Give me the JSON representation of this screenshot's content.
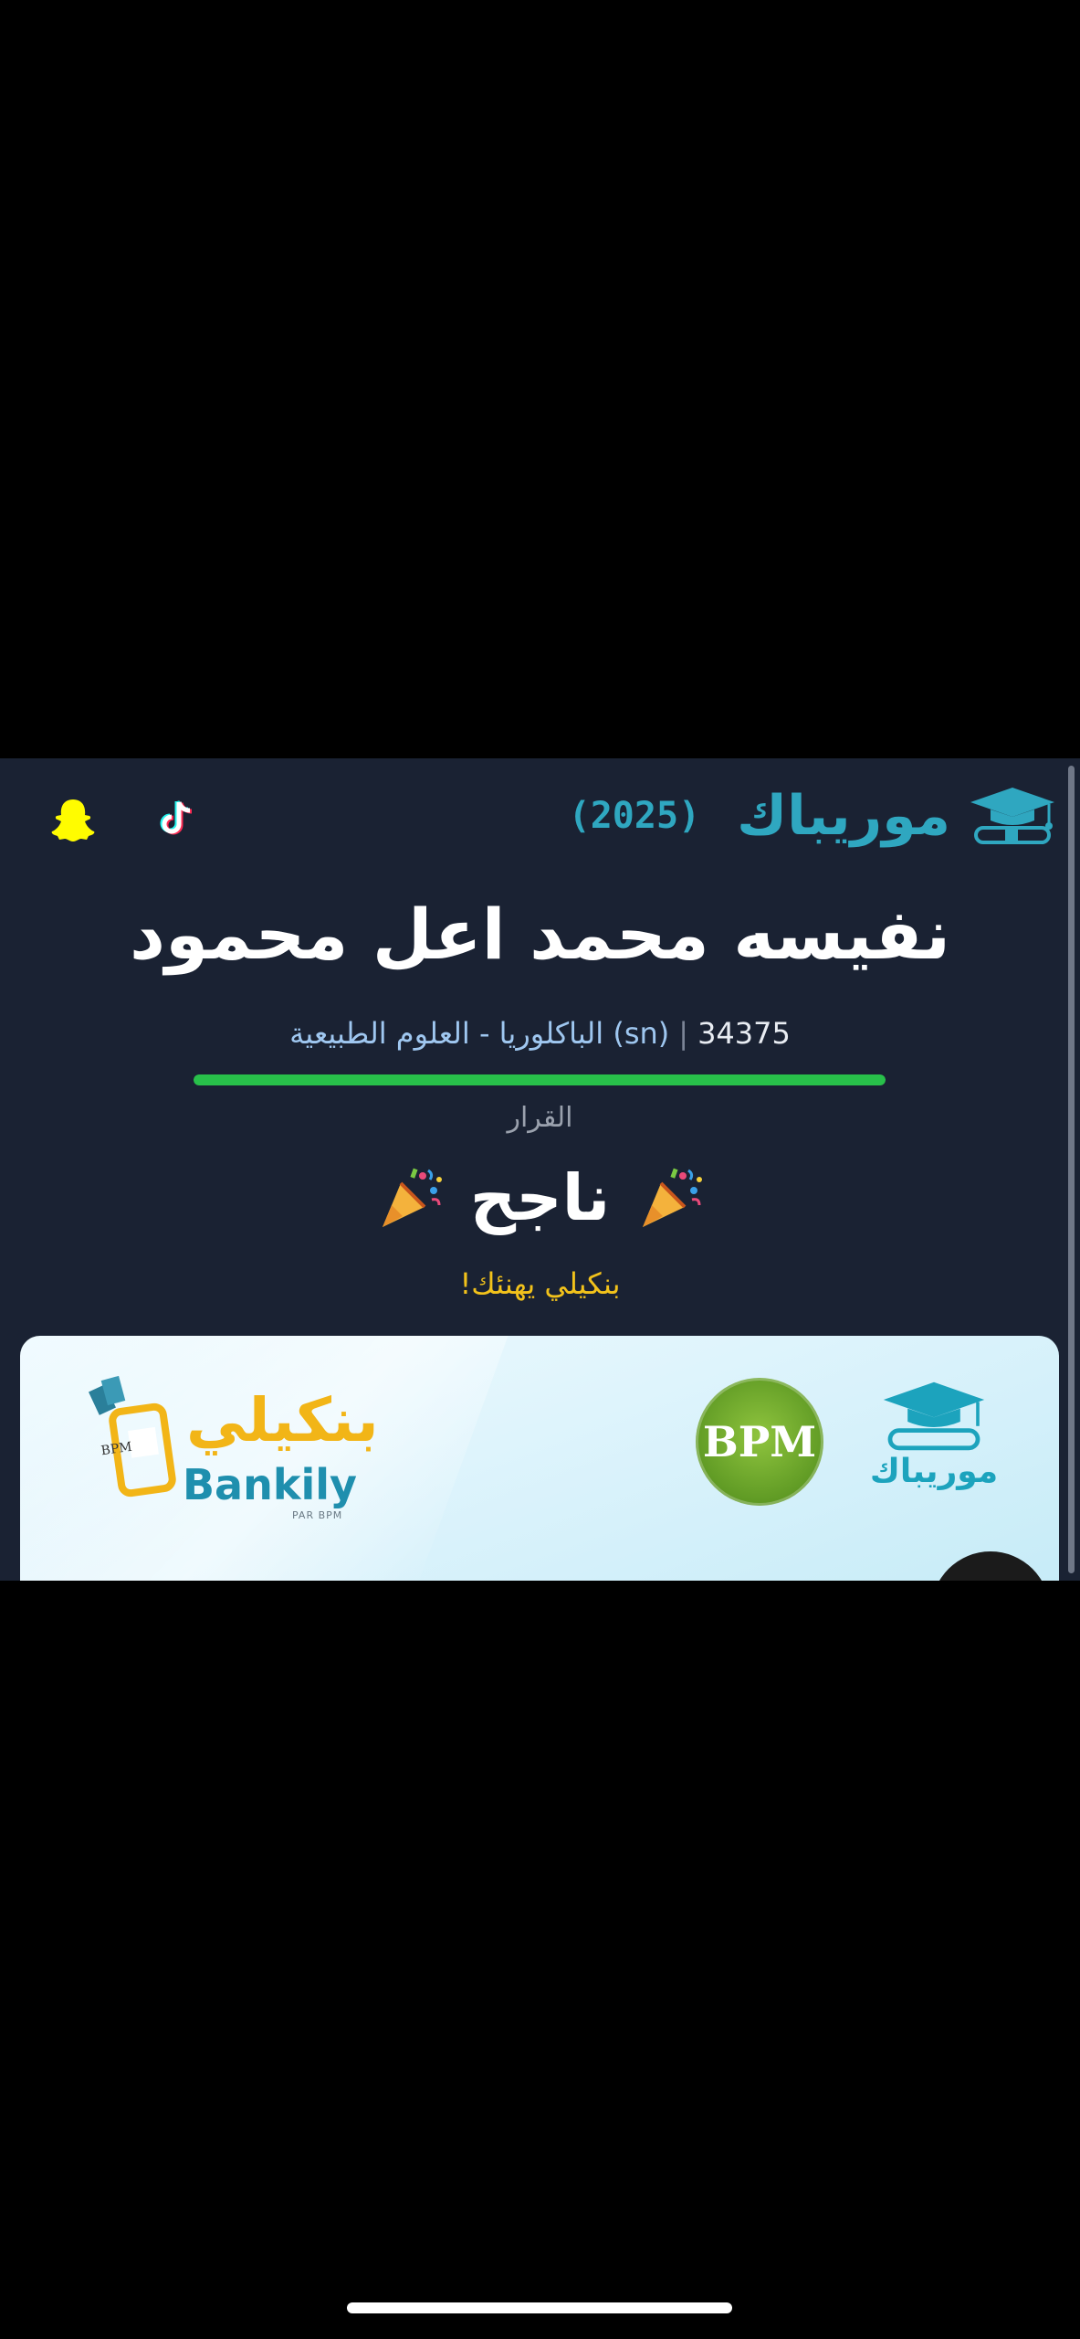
{
  "header": {
    "brand_name": "موريباك",
    "year": "(2025)",
    "icons": {
      "brand": "graduation-cap-icon",
      "tiktok": "tiktok-icon",
      "snapchat": "snapchat-icon"
    }
  },
  "student": {
    "name": "نفيسه محمد اعل محمود",
    "number": "34375",
    "separator": "|",
    "track": "الباكلوريا - العلوم الطبيعية (sn)",
    "progress": 1.0
  },
  "decision": {
    "label": "القرار",
    "value": "ناجح",
    "icon": "party-popper-icon"
  },
  "congrats": "بنكيلي يهنئك!",
  "banner": {
    "brand_name": "موريباك",
    "bpm_text": "BPM",
    "bankily_ar": "بنكيلي",
    "bankily_en": "Bankily",
    "bankily_sub": "PAR BPM",
    "phone_badge": "BPM"
  },
  "colors": {
    "background": "#000000",
    "panel": "#1a2233",
    "brand": "#2fa7c0",
    "success": "#28c04a",
    "congrats": "#f2c21b"
  }
}
